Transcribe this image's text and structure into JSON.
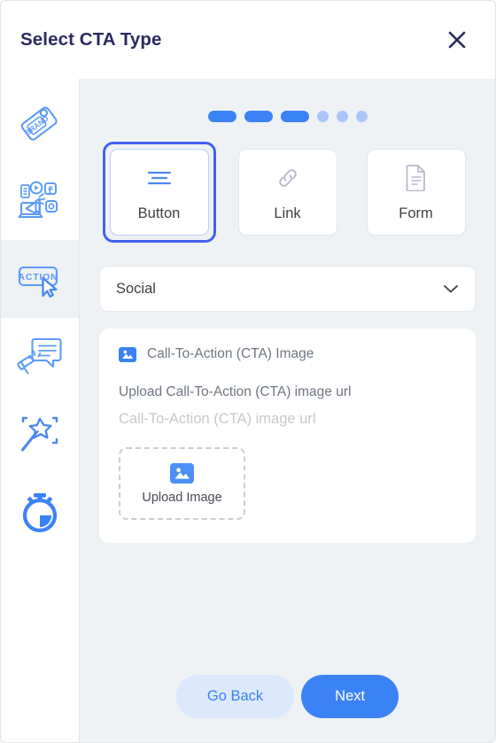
{
  "window": {
    "title": "Select CTA Type",
    "close_icon": "close-icon"
  },
  "colors": {
    "accent": "#3b82f6",
    "selected_border": "#4361ee",
    "title": "#2b2a63",
    "main_bg": "#eef2f5",
    "card_bg": "#ffffff",
    "muted_text": "#6e7680",
    "placeholder": "#c6c8cc",
    "sidebar_active_bg": "#eef2f5",
    "go_back_bg": "#dce8fb"
  },
  "sidebar": {
    "items": [
      {
        "name": "sidebar-item-brand",
        "icon": "brand-tag-icon",
        "active": false
      },
      {
        "name": "sidebar-item-marketing",
        "icon": "digital-marketing-icon",
        "active": false
      },
      {
        "name": "sidebar-item-action",
        "icon": "action-button-cursor-icon",
        "active": true
      },
      {
        "name": "sidebar-item-announcement",
        "icon": "megaphone-speech-bubble-icon",
        "active": false
      },
      {
        "name": "sidebar-item-magic",
        "icon": "magic-wand-icon",
        "active": false
      },
      {
        "name": "sidebar-item-timer",
        "icon": "stopwatch-icon",
        "active": false
      }
    ]
  },
  "progress": {
    "total_steps": 6,
    "completed_steps": 3,
    "current_step": 3
  },
  "cta_types": {
    "selected": "Button",
    "options": [
      {
        "label": "Button",
        "icon": "menu-lines-icon",
        "selected": true
      },
      {
        "label": "Link",
        "icon": "chain-link-icon",
        "selected": false
      },
      {
        "label": "Form",
        "icon": "document-form-icon",
        "selected": false
      }
    ]
  },
  "category_select": {
    "value": "Social",
    "caret_icon": "chevron-down-icon"
  },
  "cta_image": {
    "section_label": "Call-To-Action (CTA) Image",
    "section_icon": "image-icon",
    "upload_label": "Upload Call-To-Action (CTA) image url",
    "input_value": "",
    "input_placeholder": "Call-To-Action (CTA) image url",
    "dropzone": {
      "label": "Upload Image",
      "icon": "image-upload-icon"
    }
  },
  "footer": {
    "back_label": "Go Back",
    "next_label": "Next"
  }
}
